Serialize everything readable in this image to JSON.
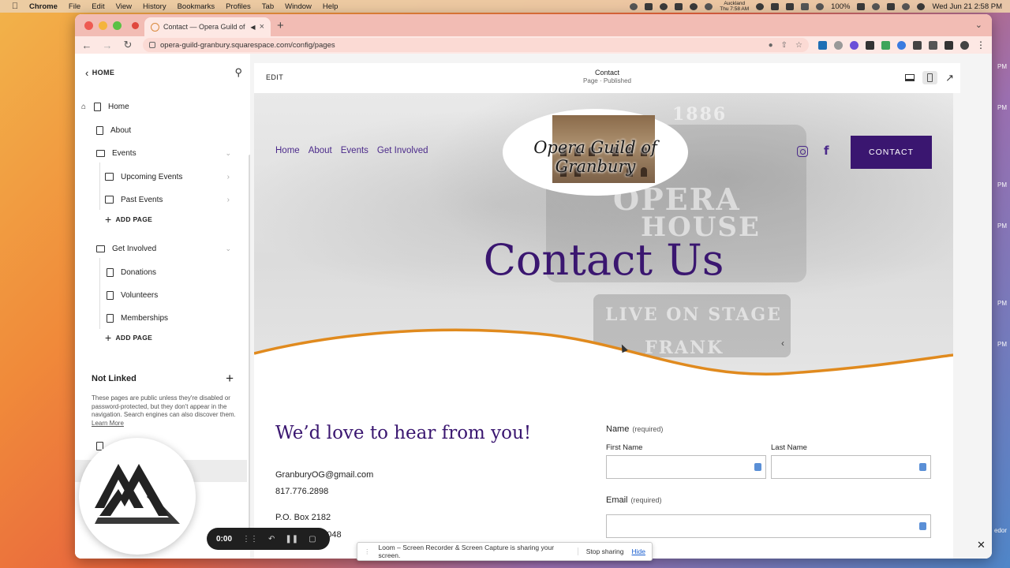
{
  "menubar": {
    "app": "Chrome",
    "items": [
      "File",
      "Edit",
      "View",
      "History",
      "Bookmarks",
      "Profiles",
      "Tab",
      "Window",
      "Help"
    ],
    "timezone_city": "Auckland",
    "timezone_time": "Thu 7:58 AM",
    "battery": "100%",
    "datetime": "Wed Jun 21  2:58 PM"
  },
  "desktop": {
    "labels": [
      "PM",
      "PM",
      "PM",
      "PM",
      "PM",
      "PM"
    ],
    "right_label": "edor"
  },
  "browser": {
    "tab_title": "Contact — Opera Guild of Granbury",
    "url": "opera-guild-granbury.squarespace.com/config/pages"
  },
  "sidebar": {
    "back_label": "HOME",
    "pages": {
      "home": "Home",
      "about": "About",
      "events": "Events",
      "upcoming_events": "Upcoming Events",
      "past_events": "Past Events",
      "get_involved": "Get Involved",
      "donations": "Donations",
      "volunteers": "Volunteers",
      "memberships": "Memberships"
    },
    "add_page": "ADD PAGE",
    "not_linked_title": "Not Linked",
    "not_linked_desc": "These pages are public unless they're disabled or password-protected, but they don't appear in the navigation. Search engines can also discover them.",
    "learn_more": "Learn More"
  },
  "editor": {
    "edit_label": "EDIT",
    "page_name": "Contact",
    "page_status": "Page · Published"
  },
  "site": {
    "nav": [
      "Home",
      "About",
      "Events",
      "Get Involved"
    ],
    "logo_text": "Opera Guild of Granbury",
    "contact_button": "CONTACT",
    "hero_title": "Contact Us",
    "hero_bg_text": {
      "year": "1886",
      "opera": "OPERA",
      "house": "HOUSE",
      "live": "LIVE ON STAGE",
      "frank": "FRANK"
    },
    "tagline": "We’d love to hear from you!",
    "email": "GranburyOG@gmail.com",
    "phone": "817.776.2898",
    "po_box": "P.O. Box 2182",
    "city_zip_visible": "76048",
    "wave_color": "#e08a1e",
    "accent_color": "#3a1670"
  },
  "form": {
    "name_label": "Name",
    "required": "(required)",
    "first_name": "First Name",
    "last_name": "Last Name",
    "email_label": "Email"
  },
  "recorder": {
    "time": "0:00"
  },
  "share_bar": {
    "message": "Loom – Screen Recorder & Screen Capture is sharing your screen.",
    "stop": "Stop sharing",
    "hide": "Hide"
  }
}
